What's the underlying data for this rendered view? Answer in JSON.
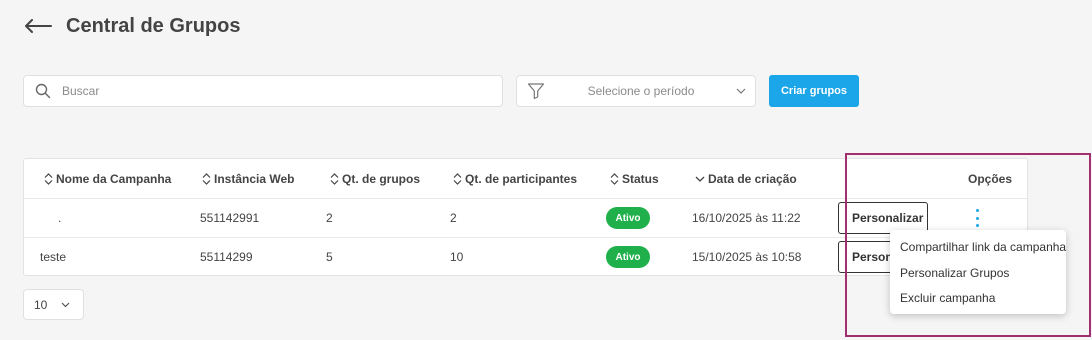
{
  "header": {
    "title": "Central de Grupos",
    "back_icon": "arrow-left-icon"
  },
  "filters": {
    "search_placeholder": "Buscar",
    "period_placeholder": "Selecione o período",
    "create_button": "Criar grupos"
  },
  "table": {
    "columns": [
      {
        "label": "Nome da Campanha",
        "sort": "both"
      },
      {
        "label": "Instância Web",
        "sort": "both"
      },
      {
        "label": "Qt. de grupos",
        "sort": "both"
      },
      {
        "label": "Qt. de participantes",
        "sort": "both"
      },
      {
        "label": "Status",
        "sort": "both"
      },
      {
        "label": "Data de criação",
        "sort": "desc"
      },
      {
        "label": "Opções",
        "sort": "none"
      }
    ],
    "rows": [
      {
        "name": ".",
        "instance": "551142991",
        "groups": "2",
        "participants": "2",
        "status": "Ativo",
        "created": "16/10/2025 às 11:22",
        "action": "Personalizar"
      },
      {
        "name": "teste",
        "instance": "55114299",
        "groups": "5",
        "participants": "10",
        "status": "Ativo",
        "created": "15/10/2025 às 10:58",
        "action": "Personalizar"
      }
    ]
  },
  "options_menu": {
    "items": [
      "Compartilhar link da campanha",
      "Personalizar Grupos",
      "Excluir campanha"
    ]
  },
  "pagination": {
    "page_size": "10"
  },
  "colors": {
    "accent": "#1aa6e8",
    "status_active": "#20b04b",
    "highlight": "#a0306e"
  }
}
